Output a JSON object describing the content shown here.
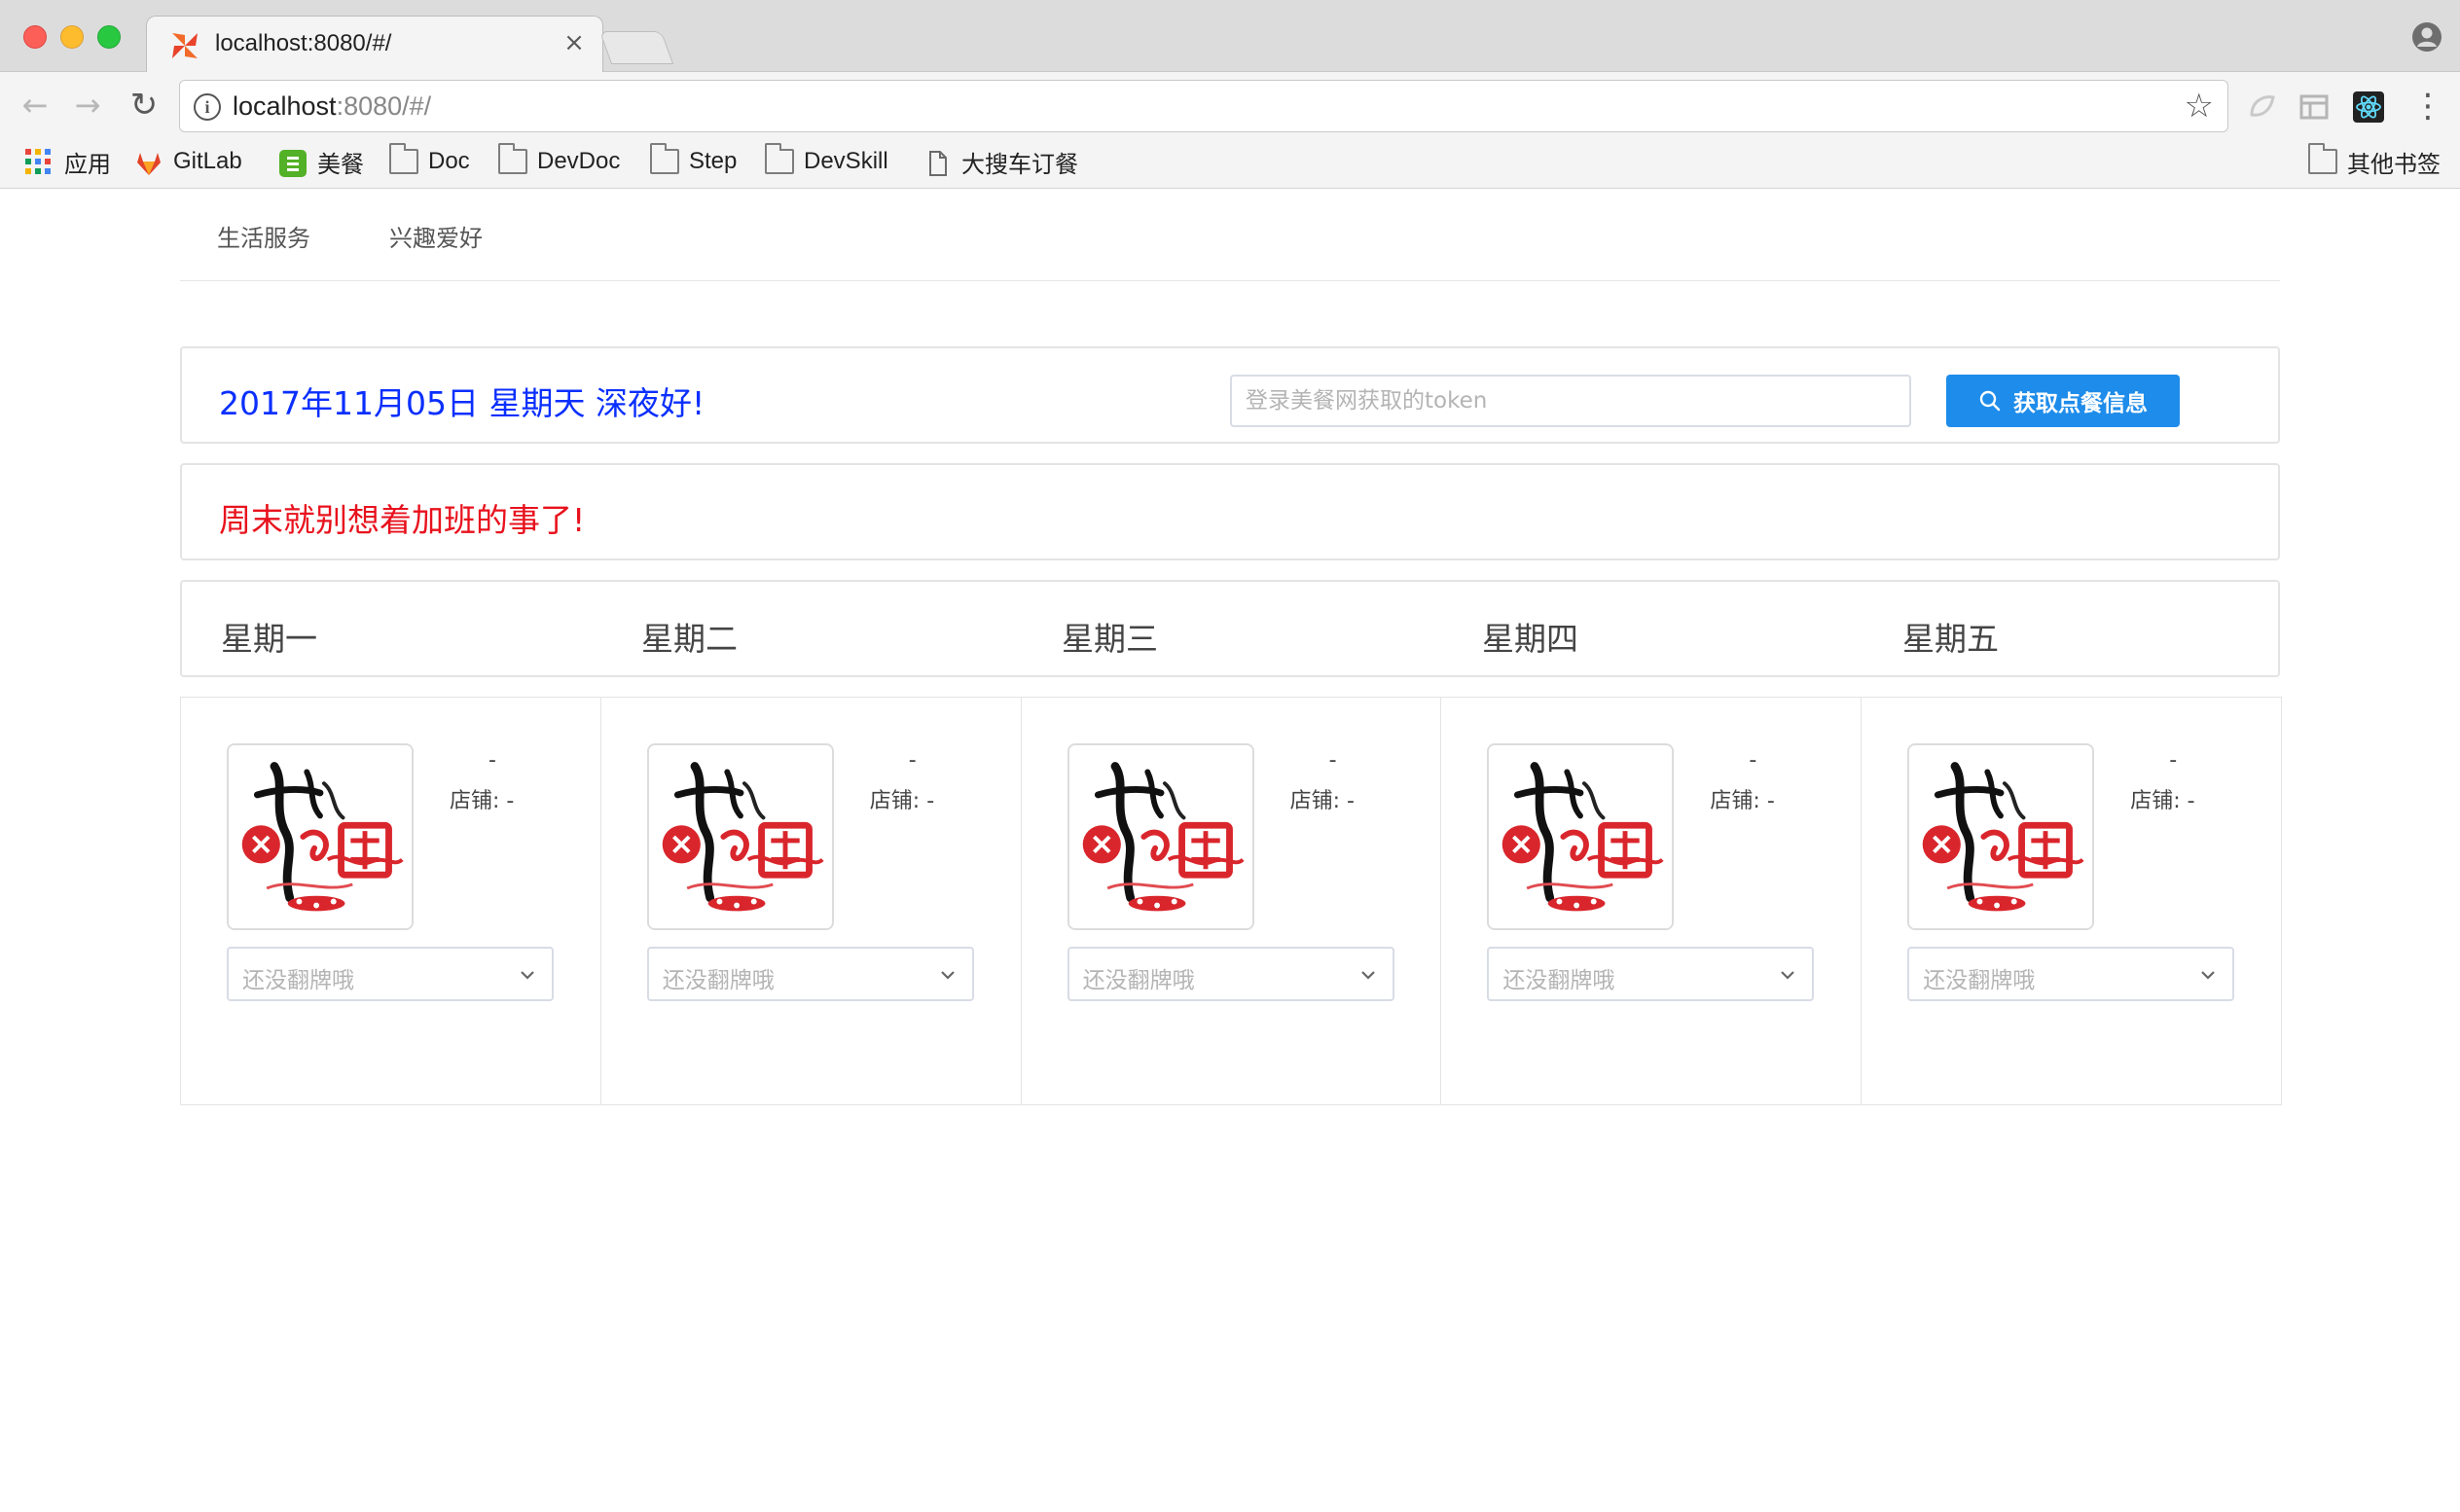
{
  "browser": {
    "tab": {
      "title": "localhost:8080/#/",
      "close_glyph": "×"
    },
    "url": {
      "host": "localhost",
      "rest": ":8080/#/"
    },
    "nav": {
      "back_glyph": "←",
      "forward_glyph": "→",
      "reload_glyph": "↻",
      "star_glyph": "☆",
      "menu_glyph": "⋮"
    },
    "bookmarks": [
      {
        "label": "应用",
        "icon": "apps-icon"
      },
      {
        "label": "GitLab",
        "icon": "gitlab-icon"
      },
      {
        "label": "美餐",
        "icon": "meican-icon"
      },
      {
        "label": "Doc",
        "icon": "folder-icon"
      },
      {
        "label": "DevDoc",
        "icon": "folder-icon"
      },
      {
        "label": "Step",
        "icon": "folder-icon"
      },
      {
        "label": "DevSkill",
        "icon": "folder-icon"
      },
      {
        "label": "大搜车订餐",
        "icon": "page-icon"
      }
    ],
    "other_bookmarks": "其他书签"
  },
  "page": {
    "nav": [
      "生活服务",
      "兴趣爱好"
    ],
    "greeting": "2017年11月05日 星期天 深夜好!",
    "token_placeholder": "登录美餐网获取的token",
    "fetch_button": "获取点餐信息",
    "notice": "周末就别想着加班的事了!",
    "days": [
      "星期一",
      "星期二",
      "星期三",
      "星期四",
      "星期五"
    ],
    "meals": [
      {
        "dish": "-",
        "shop_label": "店铺:",
        "shop": "-",
        "select_placeholder": "还没翻牌哦"
      },
      {
        "dish": "-",
        "shop_label": "店铺:",
        "shop": "-",
        "select_placeholder": "还没翻牌哦"
      },
      {
        "dish": "-",
        "shop_label": "店铺:",
        "shop": "-",
        "select_placeholder": "还没翻牌哦"
      },
      {
        "dish": "-",
        "shop_label": "店铺:",
        "shop": "-",
        "select_placeholder": "还没翻牌哦"
      },
      {
        "dish": "-",
        "shop_label": "店铺:",
        "shop": "-",
        "select_placeholder": "还没翻牌哦"
      }
    ]
  },
  "colors": {
    "greeting": "#0a2fff",
    "notice": "#e8121d",
    "primary_button": "#1e8cea"
  }
}
